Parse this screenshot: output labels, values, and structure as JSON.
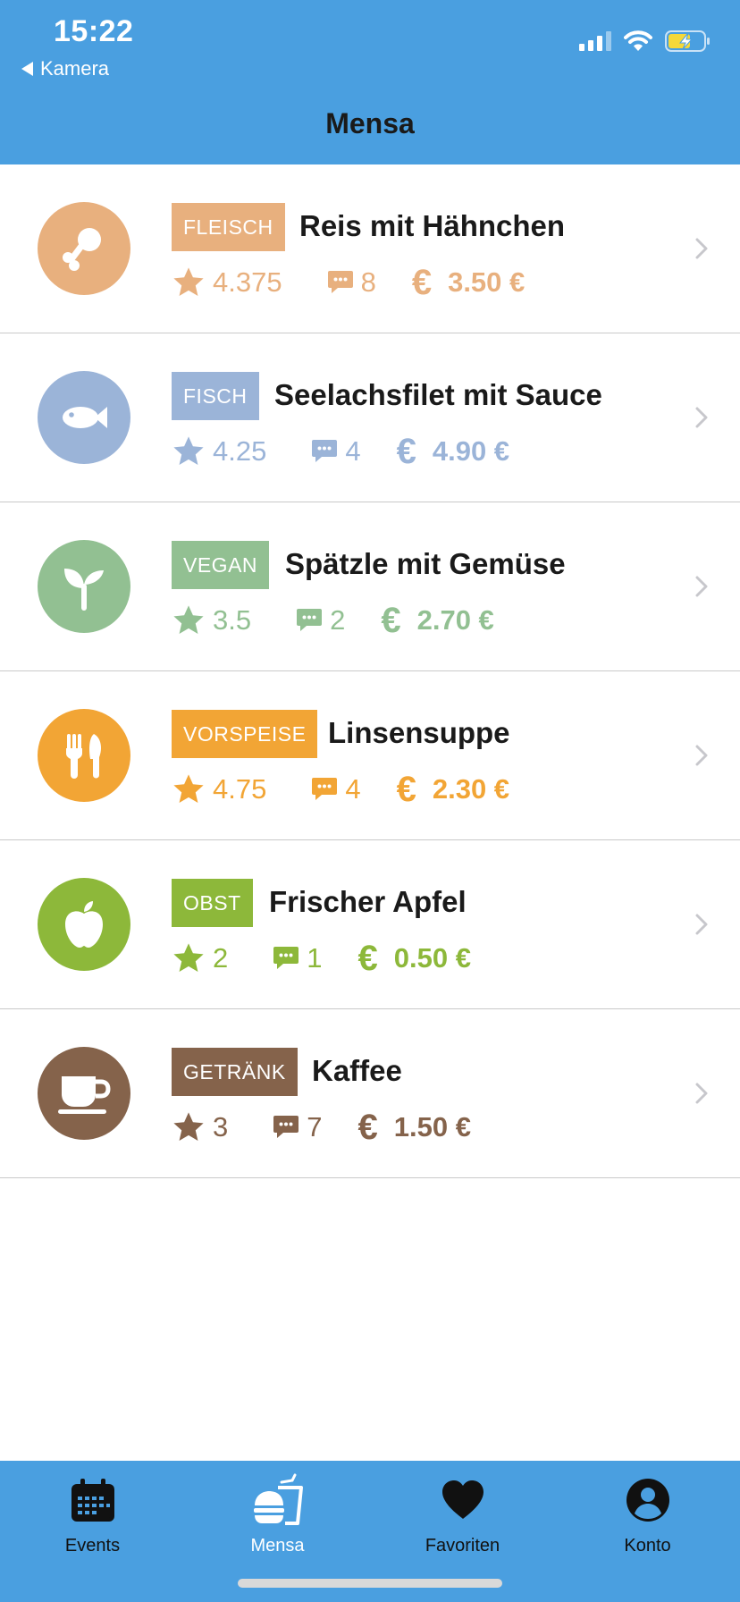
{
  "status_bar": {
    "time": "15:22",
    "back_label": "Kamera"
  },
  "nav": {
    "title": "Mensa"
  },
  "meals": [
    {
      "category": "FLEISCH",
      "name": "Reis mit Hähnchen",
      "rating": "4.375",
      "comments": "8",
      "price": "3.50 €",
      "color": "#e8b07e",
      "icon": "chicken-leg-icon"
    },
    {
      "category": "FISCH",
      "name": "Seelachsfilet mit Sauce",
      "rating": "4.25",
      "comments": "4",
      "price": "4.90 €",
      "color": "#9bb4d8",
      "icon": "fish-icon"
    },
    {
      "category": "VEGAN",
      "name": "Spätzle mit Gemüse",
      "rating": "3.5",
      "comments": "2",
      "price": "2.70 €",
      "color": "#92c092",
      "icon": "sprout-icon"
    },
    {
      "category": "VORSPEISE",
      "name": "Linsensuppe",
      "rating": "4.75",
      "comments": "4",
      "price": "2.30 €",
      "color": "#f2a535",
      "icon": "cutlery-icon"
    },
    {
      "category": "OBST",
      "name": "Frischer Apfel",
      "rating": "2",
      "comments": "1",
      "price": "0.50 €",
      "color": "#8db83a",
      "icon": "apple-icon"
    },
    {
      "category": "GETRÄNK",
      "name": "Kaffee",
      "rating": "3",
      "comments": "7",
      "price": "1.50 €",
      "color": "#85634b",
      "icon": "coffee-cup-icon"
    }
  ],
  "currency_symbol": "€",
  "tabs": [
    {
      "label": "Events",
      "icon": "calendar-icon",
      "active": false
    },
    {
      "label": "Mensa",
      "icon": "fastfood-icon",
      "active": true
    },
    {
      "label": "Favoriten",
      "icon": "heart-icon",
      "active": false
    },
    {
      "label": "Konto",
      "icon": "account-icon",
      "active": false
    }
  ],
  "colors": {
    "accent": "#4a9fe0"
  }
}
